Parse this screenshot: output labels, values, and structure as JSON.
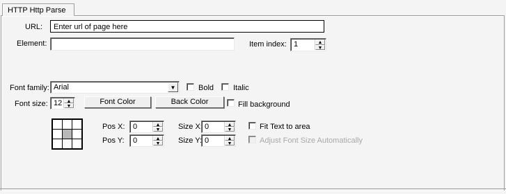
{
  "tab": {
    "label": "HTTP Http Parse"
  },
  "url": {
    "label": "URL:",
    "value": "Enter url of page here"
  },
  "element": {
    "label": "Element:",
    "value": ""
  },
  "item_index": {
    "label": "Item index:",
    "value": "1"
  },
  "font_family": {
    "label": "Font family:",
    "value": "Arial"
  },
  "bold": {
    "label": "Bold",
    "checked": false
  },
  "italic": {
    "label": "Italic",
    "checked": false
  },
  "font_size": {
    "label": "Font size:",
    "value": "12"
  },
  "font_color_button": {
    "label": "Font Color"
  },
  "back_color_button": {
    "label": "Back Color"
  },
  "fill_background": {
    "label": "Fill background",
    "checked": false
  },
  "pos_x": {
    "label": "Pos X:",
    "value": "0"
  },
  "pos_y": {
    "label": "Pos Y:",
    "value": "0"
  },
  "size_x": {
    "label": "Size X:",
    "value": "0"
  },
  "size_y": {
    "label": "Size Y:",
    "value": "0"
  },
  "fit_text": {
    "label": "Fit Text to area",
    "checked": false
  },
  "adjust_font": {
    "label": "Adjust Font Size Automatically",
    "checked": false,
    "disabled": true
  },
  "alignment_grid": {
    "selected_cell": "center"
  },
  "icons": {
    "spin_up": "▲",
    "spin_down": "▼",
    "dropdown": "▼"
  }
}
